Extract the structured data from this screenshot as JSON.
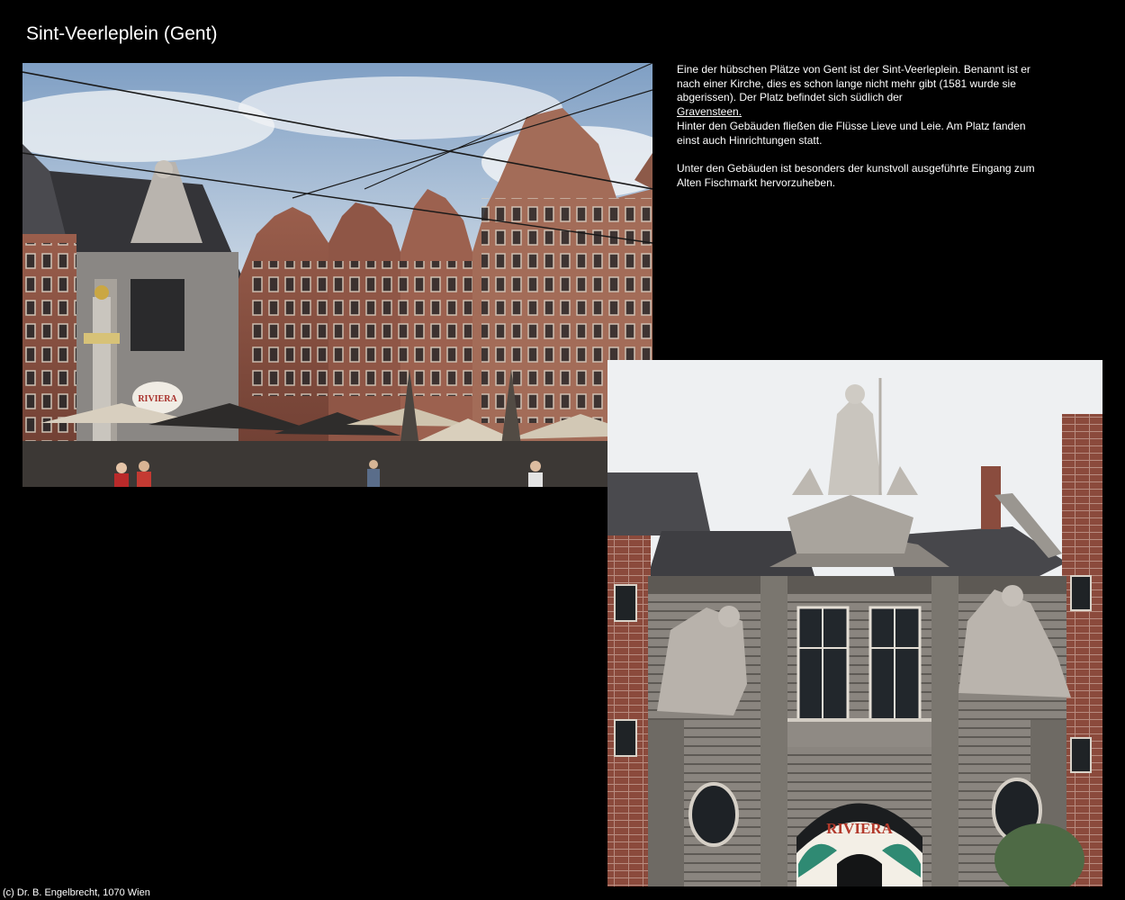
{
  "page": {
    "title": "Sint-Veerleplein (Gent)",
    "background_color": "#000000",
    "text_color": "#ffffff"
  },
  "description": {
    "paragraph1_text": "Eine der hübschen Plätze von Gent ist der Sint-Veerleplein. Benannt ist er nach einer Kirche, dies es schon lange nicht mehr gibt (1581 wurde sie abgerissen). Der Platz befindet sich südlich der",
    "link_text": "Gravensteen.",
    "paragraph2_text": "Hinter den Gebäuden fließen die Flüsse Lieve und Leie. Am Platz fanden einst auch Hinrichtungen statt.",
    "paragraph3_text": "Unter den Gebäuden ist besonders der kunstvoll ausgeführte Eingang zum Alten Fischmarkt hervorzuheben."
  },
  "photos": {
    "square": {
      "sign_text": "RIVIERA"
    },
    "entrance": {
      "sign_text": "RIVIERA"
    }
  },
  "footer": {
    "copyright": "(c) Dr. B. Engelbrecht, 1070 Wien"
  }
}
